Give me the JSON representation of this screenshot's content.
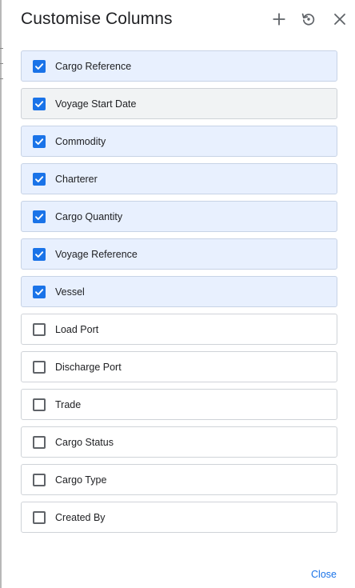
{
  "title": "Customise Columns",
  "header_icons": [
    "plus-icon",
    "reset-icon",
    "close-icon"
  ],
  "columns": [
    {
      "label": "Cargo Reference",
      "checked": true
    },
    {
      "label": "Voyage Start Date",
      "checked": true,
      "hovered": true
    },
    {
      "label": "Commodity",
      "checked": true
    },
    {
      "label": "Charterer",
      "checked": true
    },
    {
      "label": "Cargo Quantity",
      "checked": true
    },
    {
      "label": "Voyage Reference",
      "checked": true
    },
    {
      "label": "Vessel",
      "checked": true
    },
    {
      "label": "Load Port",
      "checked": false
    },
    {
      "label": "Discharge Port",
      "checked": false
    },
    {
      "label": "Trade",
      "checked": false
    },
    {
      "label": "Cargo Status",
      "checked": false
    },
    {
      "label": "Cargo Type",
      "checked": false
    },
    {
      "label": "Created By",
      "checked": false
    }
  ],
  "close_label": "Close",
  "colors": {
    "accent": "#1a73e8",
    "checked_row_bg": "#e8f0fe",
    "hover_row_bg": "#f1f3f4",
    "border": "#cfd3d8",
    "icon": "#5f6368"
  }
}
